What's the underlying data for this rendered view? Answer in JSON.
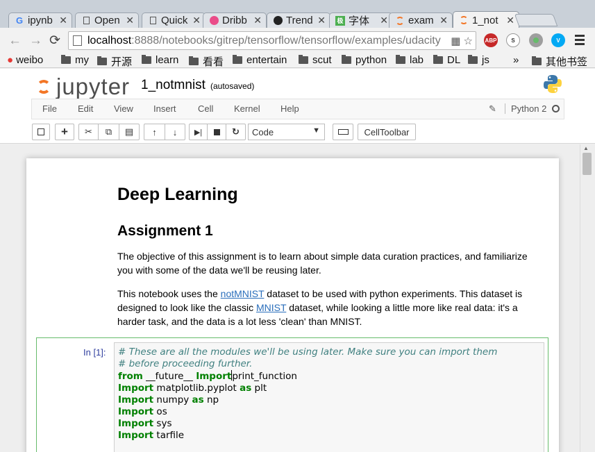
{
  "browser": {
    "tabs": [
      {
        "label": "ipynb",
        "icon": "google-icon"
      },
      {
        "label": "Open",
        "icon": "page-icon"
      },
      {
        "label": "Quick",
        "icon": "page-icon"
      },
      {
        "label": "Dribb",
        "icon": "dribbble-icon"
      },
      {
        "label": "Trend",
        "icon": "github-icon"
      },
      {
        "label": "字体",
        "icon": "font-site-icon"
      },
      {
        "label": "exam",
        "icon": "jupyter-icon"
      },
      {
        "label": "1_not",
        "icon": "jupyter-icon"
      }
    ],
    "url_host": "localhost",
    "url_rest": ":8888/notebooks/gitrep/tensorflow/tensorflow/examples/udacity",
    "bookmarks": [
      "weibo",
      "my",
      "开源",
      "learn",
      "看看",
      "entertain",
      "scut",
      "python",
      "lab",
      "DL",
      "js"
    ],
    "bookmarks_overflow": "»",
    "other_bookmarks": "其他书签",
    "extensions": [
      "ABP"
    ]
  },
  "jupyter": {
    "logo_text": "jupyter",
    "notebook_name": "1_notmnist",
    "autosave_status": "(autosaved)",
    "menu": [
      "File",
      "Edit",
      "View",
      "Insert",
      "Cell",
      "Kernel",
      "Help"
    ],
    "kernel_name": "Python 2",
    "cell_type_select": "Code",
    "celltoolbar_label": "CellToolbar"
  },
  "notebook": {
    "h1": "Deep Learning",
    "h2": "Assignment 1",
    "p1": "The objective of this assignment is to learn about simple data curation practices, and familiarize you with some of the data we'll be reusing later.",
    "p2_a": "This notebook uses the ",
    "p2_link1": "notMNIST",
    "p2_b": " dataset to be used with python experiments. This dataset is designed to look like the classic ",
    "p2_link2": "MNIST",
    "p2_c": " dataset, while looking a little more like real data: it's a harder task, and the data is a lot less 'clean' than MNIST.",
    "prompt": "In [1]:",
    "code": {
      "comment1": "# These are all the modules we'll be using later. Make sure you can import them",
      "comment2": "# before proceeding further.",
      "l3_kw1": "from",
      "l3_mod": " __future__ ",
      "l3_kw2": "Import",
      "l3_name": "print_function",
      "l4_kw": "Import",
      "l4_mod": " matplotlib.pyplot ",
      "l4_as": "as",
      "l4_alias": " plt",
      "l5_kw": "Import",
      "l5_mod": " numpy ",
      "l5_as": "as",
      "l5_alias": " np",
      "l6_kw": "Import",
      "l6_mod": " os",
      "l7_kw": "Import",
      "l7_mod": " sys",
      "l8_kw": "Import",
      "l8_mod": " tarfile"
    }
  },
  "colors": {
    "jupyter_orange": "#f37626",
    "link_blue": "#2a6ebb",
    "cell_border_green": "#66bb6a",
    "keyword_green": "#008000",
    "comment_teal": "#408080",
    "prompt_blue": "#303f9f"
  }
}
